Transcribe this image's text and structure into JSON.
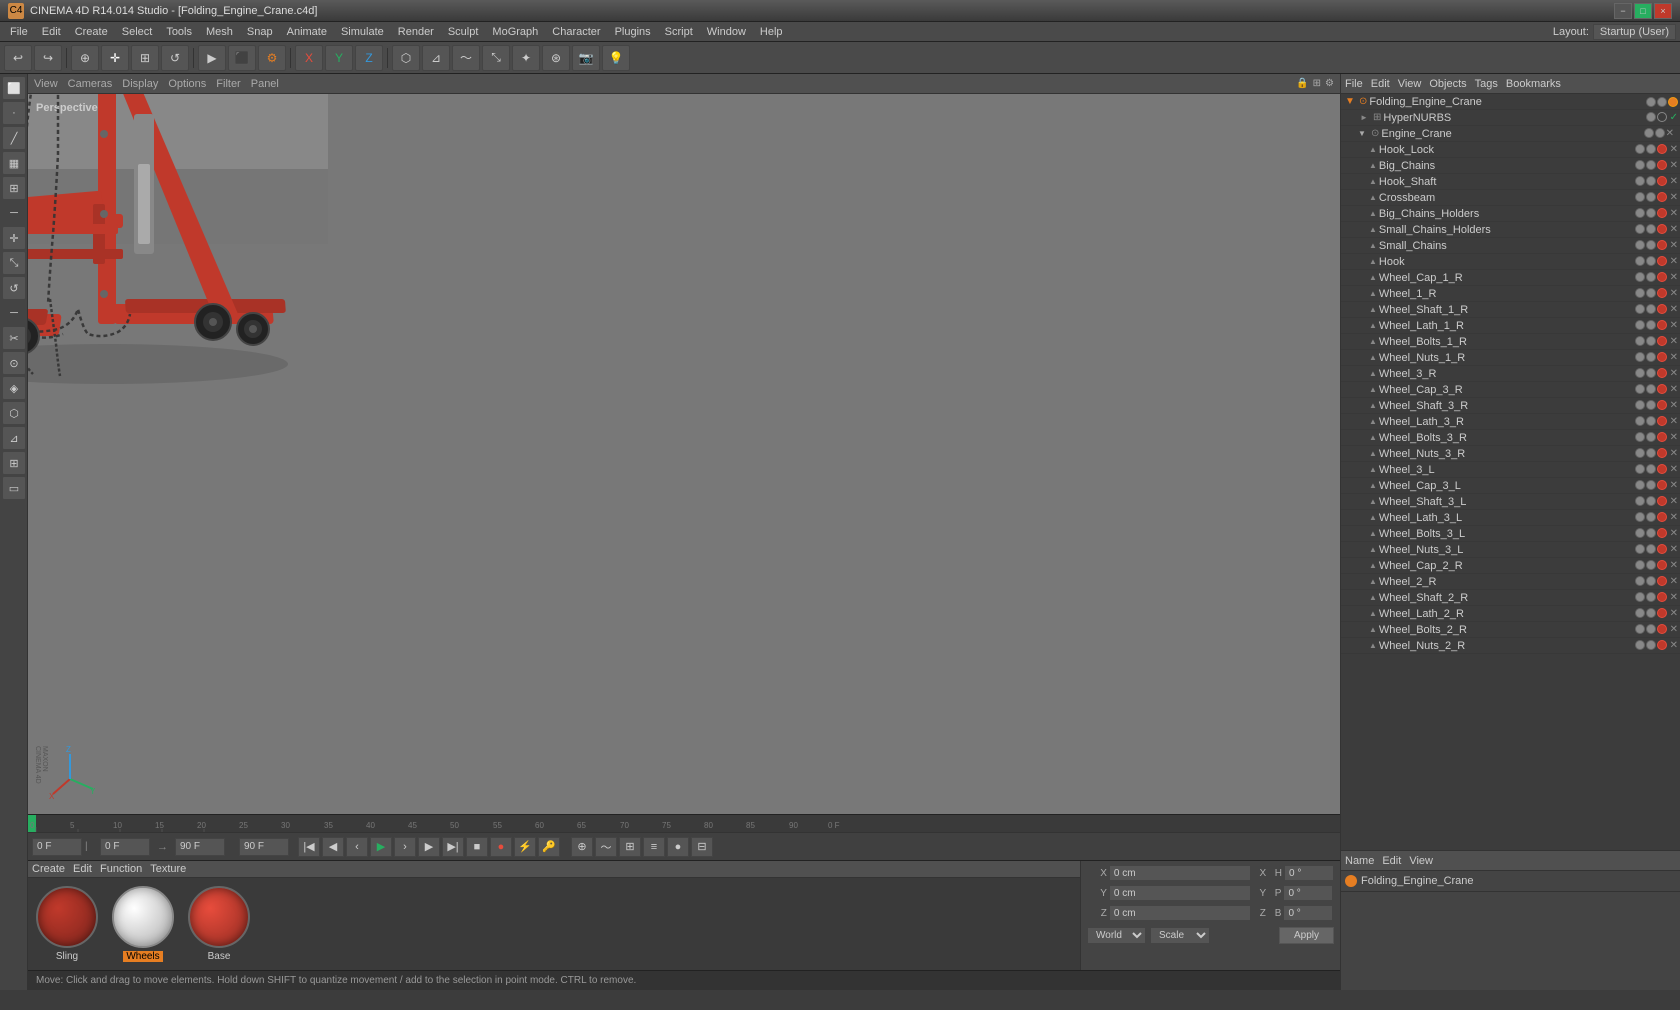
{
  "app": {
    "title": "CINEMA 4D R14.014 Studio - [Folding_Engine_Crane.c4d]",
    "icon": "C4D"
  },
  "titlebar": {
    "title": "CINEMA 4D R14.014 Studio - [Folding_Engine_Crane.c4d]",
    "minimize": "−",
    "maximize": "□",
    "close": "×"
  },
  "menubar": {
    "items": [
      "File",
      "Edit",
      "Create",
      "Select",
      "Tools",
      "Mesh",
      "Snap",
      "Animate",
      "Simulate",
      "Render",
      "Sculpt",
      "MoGraph",
      "Character",
      "Plugins",
      "Script",
      "Window",
      "Help"
    ],
    "layout_label": "Layout:",
    "layout_value": "Startup (User)"
  },
  "viewport": {
    "header_items": [
      "View",
      "Cameras",
      "Display",
      "Options",
      "Filter",
      "Panel"
    ],
    "perspective_label": "Perspective",
    "camera_label": "Perspective"
  },
  "object_manager": {
    "menus": [
      "File",
      "Edit",
      "View",
      "Objects",
      "Tags",
      "Bookmarks"
    ],
    "root": "Folding_Engine_Crane",
    "items": [
      {
        "indent": 0,
        "name": "Folding_Engine_Crane",
        "type": "root",
        "has_orange": true
      },
      {
        "indent": 1,
        "name": "HyperNURBS",
        "type": "nurbs",
        "has_check": true
      },
      {
        "indent": 1,
        "name": "Engine_Crane",
        "type": "group"
      },
      {
        "indent": 2,
        "name": "Hook_Lock",
        "type": "obj"
      },
      {
        "indent": 2,
        "name": "Big_Chains",
        "type": "obj"
      },
      {
        "indent": 2,
        "name": "Hook_Shaft",
        "type": "obj"
      },
      {
        "indent": 2,
        "name": "Crossbeam",
        "type": "obj"
      },
      {
        "indent": 2,
        "name": "Big_Chains_Holders",
        "type": "obj"
      },
      {
        "indent": 2,
        "name": "Small_Chains_Holders",
        "type": "obj"
      },
      {
        "indent": 2,
        "name": "Small_Chains",
        "type": "obj"
      },
      {
        "indent": 2,
        "name": "Hook",
        "type": "obj"
      },
      {
        "indent": 2,
        "name": "Wheel_Cap_1_R",
        "type": "obj"
      },
      {
        "indent": 2,
        "name": "Wheel_1_R",
        "type": "obj"
      },
      {
        "indent": 2,
        "name": "Wheel_Shaft_1_R",
        "type": "obj"
      },
      {
        "indent": 2,
        "name": "Wheel_Lath_1_R",
        "type": "obj"
      },
      {
        "indent": 2,
        "name": "Wheel_Bolts_1_R",
        "type": "obj"
      },
      {
        "indent": 2,
        "name": "Wheel_Nuts_1_R",
        "type": "obj"
      },
      {
        "indent": 2,
        "name": "Wheel_3_R",
        "type": "obj"
      },
      {
        "indent": 2,
        "name": "Wheel_Cap_3_R",
        "type": "obj"
      },
      {
        "indent": 2,
        "name": "Wheel_Shaft_3_R",
        "type": "obj"
      },
      {
        "indent": 2,
        "name": "Wheel_Lath_3_R",
        "type": "obj"
      },
      {
        "indent": 2,
        "name": "Wheel_Bolts_3_R",
        "type": "obj"
      },
      {
        "indent": 2,
        "name": "Wheel_Nuts_3_R",
        "type": "obj"
      },
      {
        "indent": 2,
        "name": "Wheel_3_L",
        "type": "obj"
      },
      {
        "indent": 2,
        "name": "Wheel_Cap_3_L",
        "type": "obj"
      },
      {
        "indent": 2,
        "name": "Wheel_Shaft_3_L",
        "type": "obj"
      },
      {
        "indent": 2,
        "name": "Wheel_Lath_3_L",
        "type": "obj"
      },
      {
        "indent": 2,
        "name": "Wheel_Bolts_3_L",
        "type": "obj"
      },
      {
        "indent": 2,
        "name": "Wheel_Nuts_3_L",
        "type": "obj"
      },
      {
        "indent": 2,
        "name": "Wheel_Cap_2_R",
        "type": "obj"
      },
      {
        "indent": 2,
        "name": "Wheel_2_R",
        "type": "obj"
      },
      {
        "indent": 2,
        "name": "Wheel_Shaft_2_R",
        "type": "obj"
      },
      {
        "indent": 2,
        "name": "Wheel_Lath_2_R",
        "type": "obj"
      },
      {
        "indent": 2,
        "name": "Wheel_Bolts_2_R",
        "type": "obj"
      },
      {
        "indent": 2,
        "name": "Wheel_Nuts_2_R",
        "type": "obj"
      }
    ]
  },
  "attributes": {
    "menus": [
      "Name",
      "Edit",
      "View"
    ],
    "selected_name": "Folding_Engine_Crane",
    "coords": {
      "x_pos": "0 cm",
      "y_pos": "0 cm",
      "z_pos": "0 cm",
      "x_rot": "0 °",
      "y_rot": "0 °",
      "z_rot": "0 °",
      "h": "0 °",
      "p": "0 °",
      "b": "0 °",
      "sx": "",
      "sy": "",
      "sz": ""
    },
    "coord_mode": "World",
    "transform_mode": "Scale",
    "apply_btn": "Apply"
  },
  "timeline": {
    "frame_numbers": [
      "0",
      "5",
      "10",
      "15",
      "20",
      "25",
      "30",
      "35",
      "40",
      "45",
      "50",
      "55",
      "60",
      "65",
      "70",
      "75",
      "80",
      "85",
      "90"
    ],
    "current_frame": "0 F",
    "start_frame": "0 F",
    "end_frame": "90 F",
    "fps": "90 F"
  },
  "playback": {
    "current_frame_field": "0 F",
    "start_field": "0 F",
    "end_field": "90 F",
    "play_btn": "▶",
    "prev_btn": "◀◀",
    "next_btn": "▶▶",
    "stop_btn": "■",
    "record_btn": "●"
  },
  "materials": [
    {
      "name": "Sling",
      "color": "#8B1010"
    },
    {
      "name": "Wheels",
      "color": "#eeeeee",
      "selected": true
    },
    {
      "name": "Base",
      "color": "#cc2222"
    }
  ],
  "coords_panel": {
    "x_label": "X",
    "y_label": "Y",
    "z_label": "Z",
    "x_pos": "0 cm",
    "y_pos": "0 cm",
    "z_pos": "0 cm",
    "x_pos2": "0 cm",
    "y_pos2": "0 cm",
    "z_pos2": "0 cm",
    "h_label": "H",
    "h_val": "0 °",
    "p_label": "P",
    "p_val": "0 °",
    "b_label": "B",
    "b_val": "0 °",
    "mode": "World",
    "transform": "Scale",
    "apply": "Apply"
  },
  "statusbar": {
    "text": "Move: Click and drag to move elements. Hold down SHIFT to quantize movement / add to the selection in point mode. CTRL to remove."
  }
}
